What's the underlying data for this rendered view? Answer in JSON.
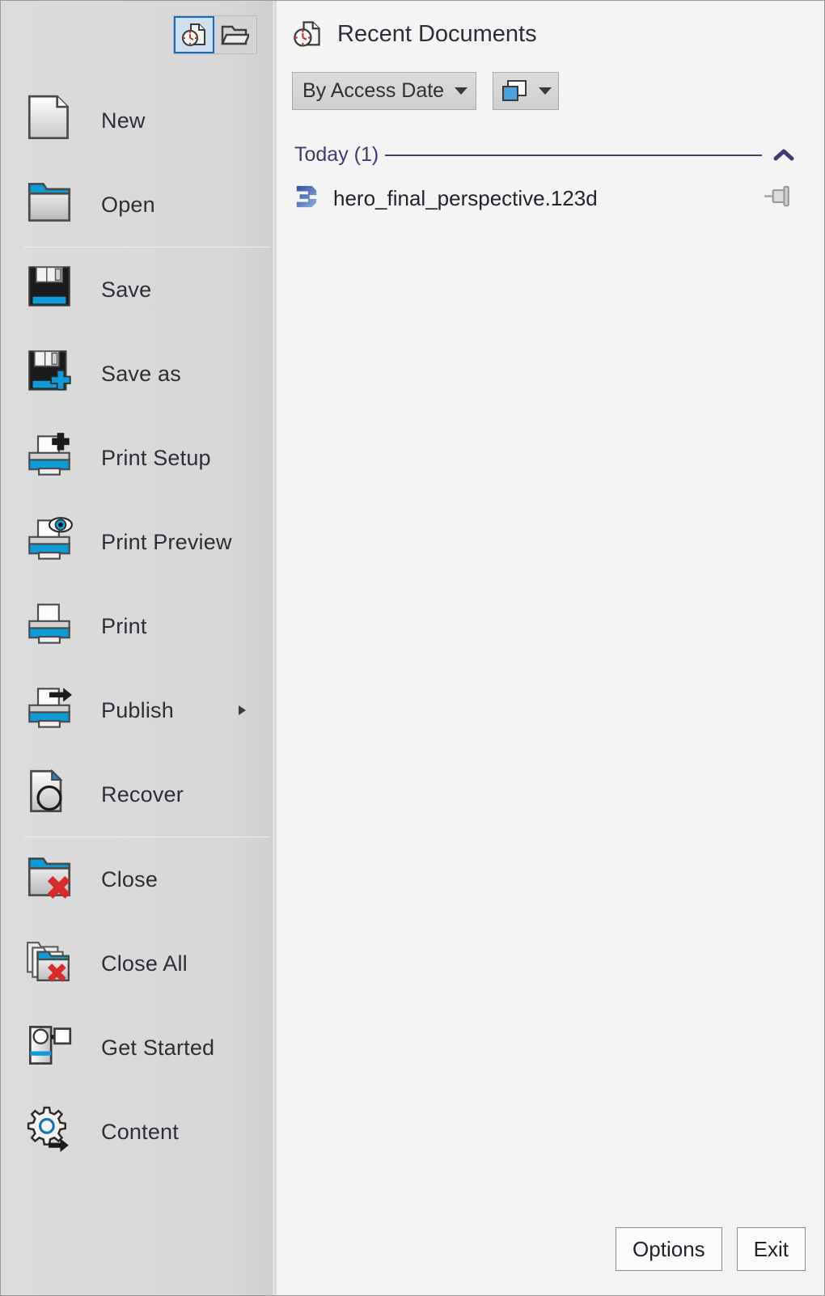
{
  "window": {
    "background": "#d9d9d9",
    "panel_background": "#f4f4f4",
    "accent": "#1a6bbd",
    "group_color": "#3c3c6e"
  },
  "tabs": [
    {
      "name": "recent-documents-tab",
      "icon": "recent-documents-icon",
      "selected": true
    },
    {
      "name": "open-documents-tab",
      "icon": "open-folder-icon",
      "selected": false
    }
  ],
  "menu": {
    "items": [
      {
        "label": "New",
        "icon": "new-document-icon",
        "submenu": false,
        "separator_after": false
      },
      {
        "label": "Open",
        "icon": "open-folder-icon",
        "submenu": false,
        "separator_after": true
      },
      {
        "label": "Save",
        "icon": "floppy-disk-icon",
        "submenu": false,
        "separator_after": false
      },
      {
        "label": "Save as",
        "icon": "floppy-disk-plus-icon",
        "submenu": false,
        "separator_after": false
      },
      {
        "label": "Print Setup",
        "icon": "printer-plus-icon",
        "submenu": false,
        "separator_after": false
      },
      {
        "label": "Print Preview",
        "icon": "printer-eye-icon",
        "submenu": false,
        "separator_after": false
      },
      {
        "label": "Print",
        "icon": "printer-icon",
        "submenu": false,
        "separator_after": false
      },
      {
        "label": "Publish",
        "icon": "printer-arrow-icon",
        "submenu": true,
        "separator_after": false
      },
      {
        "label": "Recover",
        "icon": "document-recover-icon",
        "submenu": false,
        "separator_after": true
      },
      {
        "label": "Close",
        "icon": "folder-close-icon",
        "submenu": false,
        "separator_after": false
      },
      {
        "label": "Close All",
        "icon": "folders-close-icon",
        "submenu": false,
        "separator_after": false
      },
      {
        "label": "Get Started",
        "icon": "projector-icon",
        "submenu": false,
        "separator_after": false
      },
      {
        "label": "Content",
        "icon": "gear-arrow-icon",
        "submenu": false,
        "separator_after": false
      }
    ]
  },
  "recent": {
    "title": "Recent Documents",
    "title_icon": "recent-documents-icon",
    "sort": {
      "selected": "By Access Date",
      "icon": "chevron-down-icon"
    },
    "grouping": {
      "icon": "window-group-icon",
      "caret": "chevron-down-icon"
    },
    "group": {
      "label": "Today (1)",
      "collapse_icon": "chevron-up-icon",
      "expanded": true
    },
    "files": [
      {
        "name": "hero_final_perspective.123d",
        "icon": "123d-file-icon",
        "pin_icon": "pin-icon",
        "pinned": false
      }
    ]
  },
  "footer": {
    "options_label": "Options",
    "exit_label": "Exit"
  }
}
